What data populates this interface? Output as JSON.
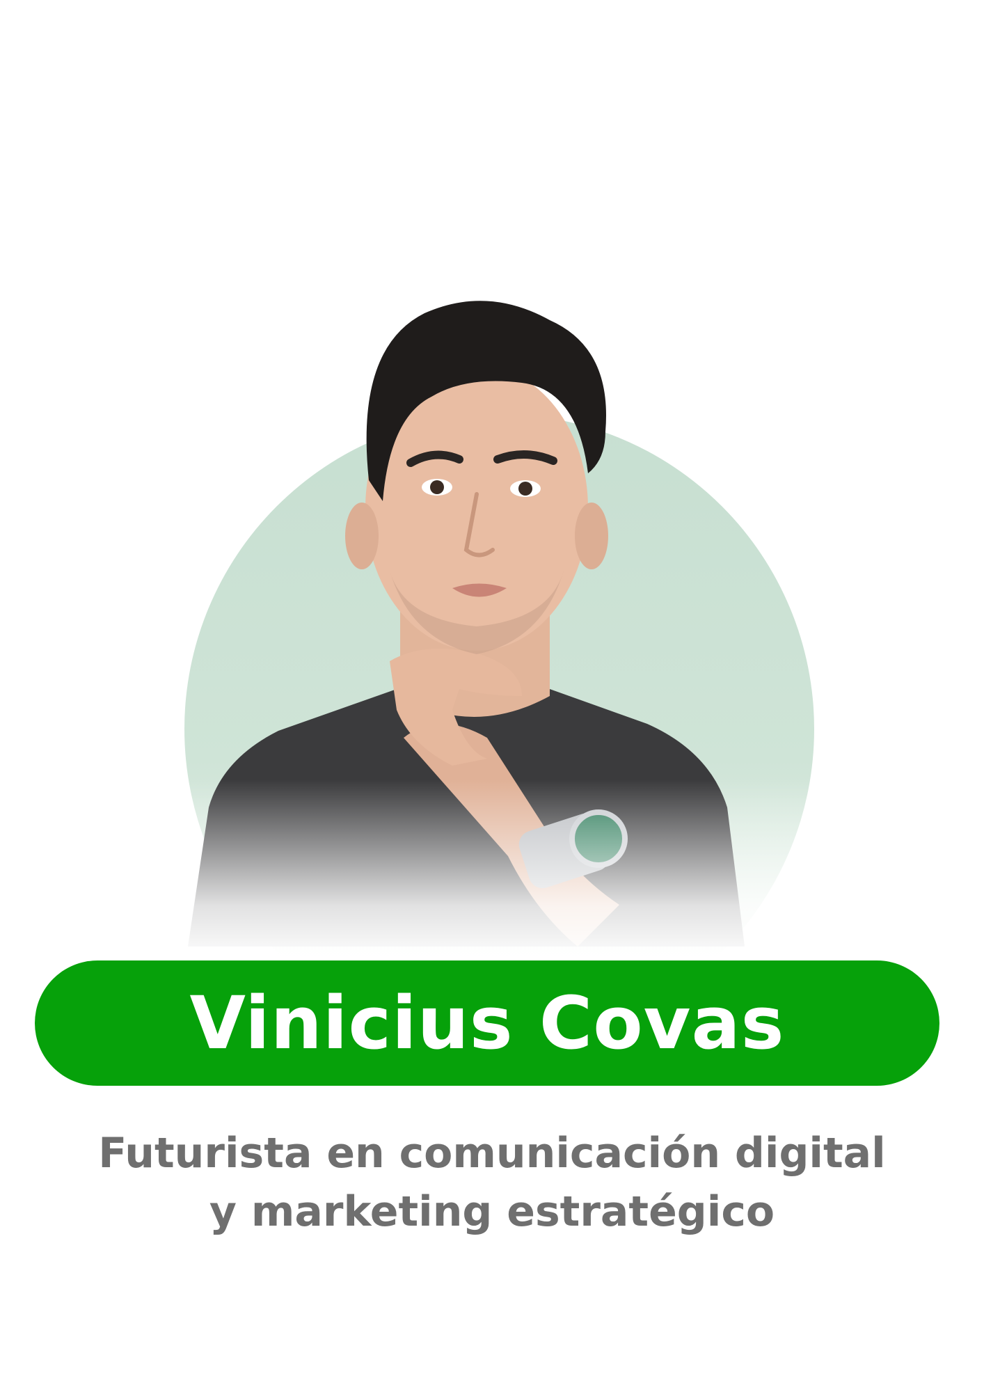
{
  "colors": {
    "banner": "#06a10a",
    "circle": "#c7dfd1",
    "subtitle": "#6f6f6f",
    "name_text": "#ffffff"
  },
  "profile": {
    "name": "Vinicius Covas",
    "subtitle_line_1": "Futurista en comunicación digital",
    "subtitle_line_2": "y marketing estratégico"
  }
}
